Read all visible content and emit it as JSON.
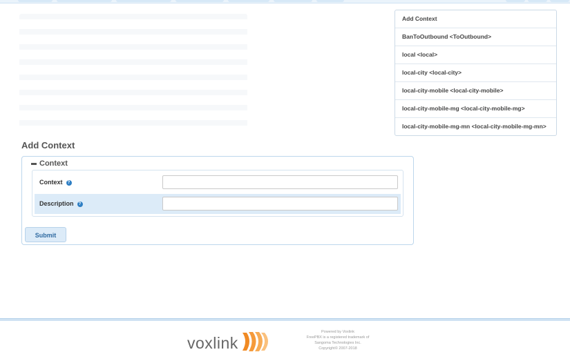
{
  "side_list": {
    "items": [
      {
        "label": "Add Context"
      },
      {
        "label": "BanToOutbound <ToOutbound>"
      },
      {
        "label": "local <local>"
      },
      {
        "label": "local-city <local-city>"
      },
      {
        "label": "local-city-mobile <local-city-mobile>"
      },
      {
        "label": "local-city-mobile-mg <local-city-mobile-mg>"
      },
      {
        "label": "local-city-mobile-mg-mn <local-city-mobile-mg-mn>"
      }
    ]
  },
  "form": {
    "title": "Add Context",
    "section_label": "Context",
    "fields": {
      "context": {
        "label": "Context",
        "value": "",
        "placeholder": ""
      },
      "description": {
        "label": "Description",
        "value": "",
        "placeholder": ""
      }
    },
    "submit_label": "Submit"
  },
  "footer": {
    "logo_text": "voxlink",
    "powered_by": "Powered by Voxlink",
    "trademark": "FreePBX is a registered trademark of",
    "company": "Sangoma Technologies Inc.",
    "copyright": "Copyright© 2007-2018"
  },
  "colors": {
    "accent": "#2f7fc4",
    "row_highlight": "#dcebf8",
    "logo_orange": "#f08a24"
  }
}
